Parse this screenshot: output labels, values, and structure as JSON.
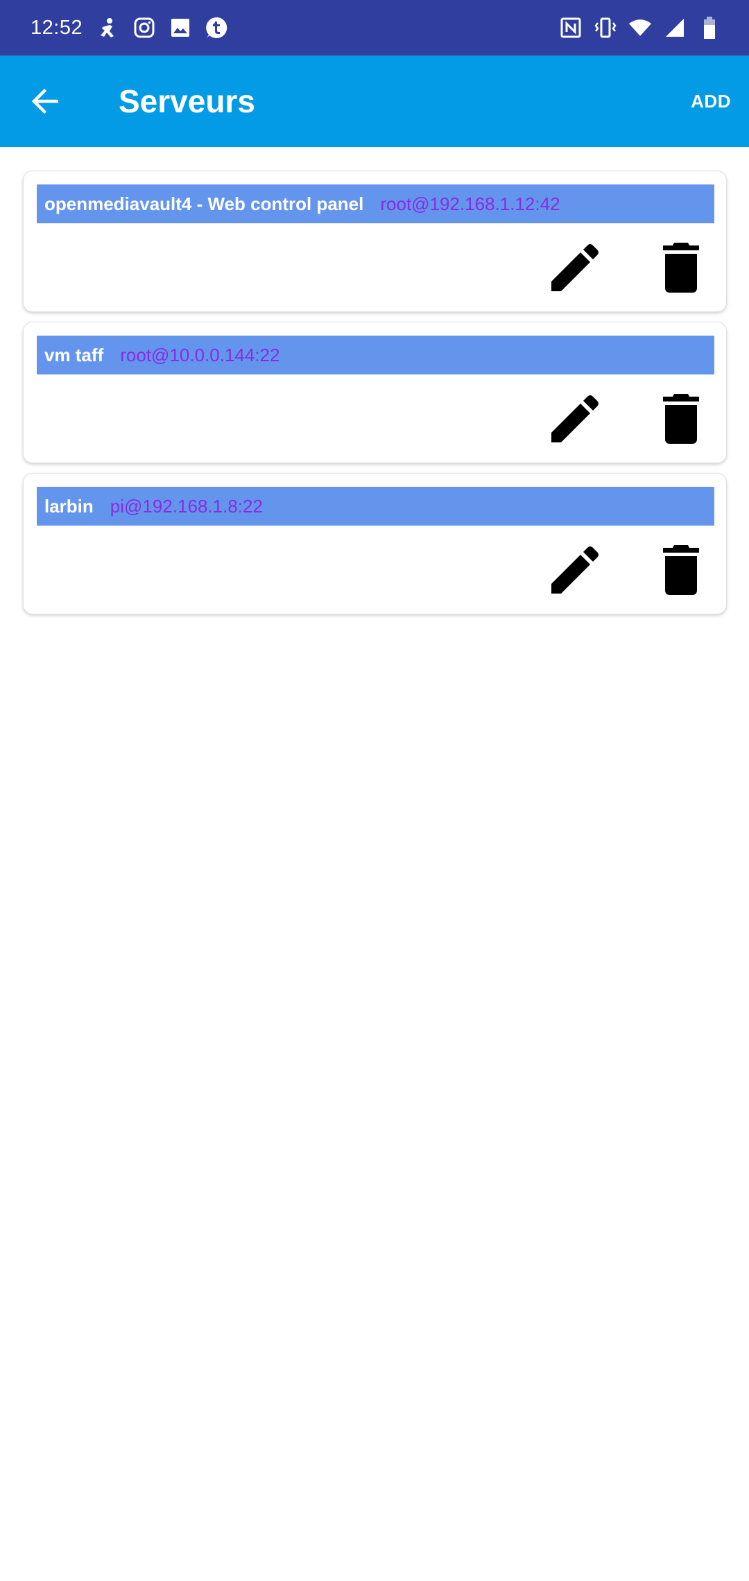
{
  "status_bar": {
    "time": "12:52",
    "left_icons": [
      "accessibility-icon",
      "instagram-icon",
      "image-icon",
      "tumblr-icon"
    ],
    "right_icons": [
      "nfc-icon",
      "vibrate-icon",
      "wifi-icon",
      "signal-icon",
      "battery-icon"
    ],
    "background": "#303f9f"
  },
  "app_bar": {
    "title": "Serveurs",
    "add_label": "ADD",
    "back_icon": "arrow-back-icon",
    "background": "#039be5"
  },
  "servers": [
    {
      "name": "openmediavault4 - Web control panel",
      "address": "root@192.168.1.12:42",
      "edit_icon": "pencil-icon",
      "delete_icon": "trash-icon"
    },
    {
      "name": "vm taff",
      "address": "root@10.0.0.144:22",
      "edit_icon": "pencil-icon",
      "delete_icon": "trash-icon"
    },
    {
      "name": "larbin",
      "address": "pi@192.168.1.8:22",
      "edit_icon": "pencil-icon",
      "delete_icon": "trash-icon"
    }
  ],
  "colors": {
    "header_strip": "#6495ed",
    "server_name": "#ffffff",
    "server_address": "#8a2be2"
  }
}
